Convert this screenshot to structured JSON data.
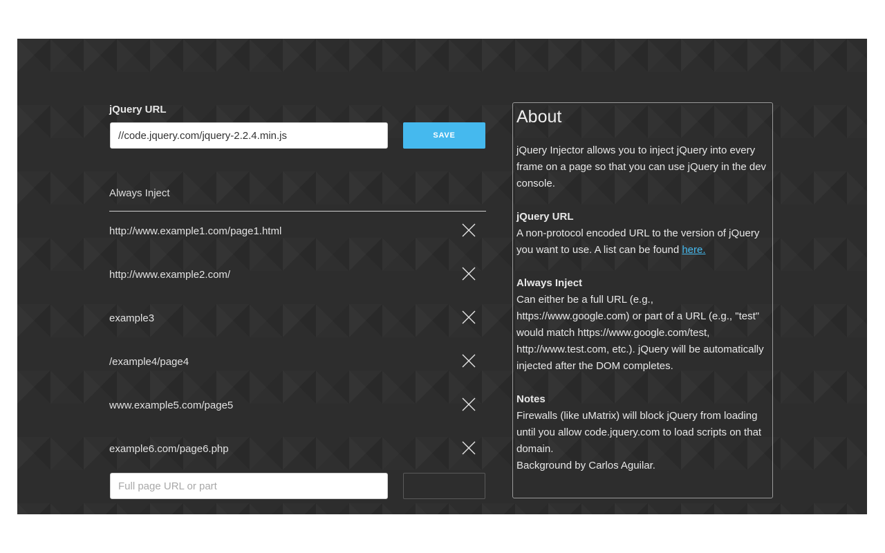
{
  "settings": {
    "jquery_url_label": "jQuery URL",
    "jquery_url_value": "//code.jquery.com/jquery-2.2.4.min.js",
    "save_label": "SAVE",
    "always_inject_label": "Always Inject",
    "inject_items": [
      "http://www.example1.com/page1.html",
      "http://www.example2.com/",
      "example3",
      "/example4/page4",
      "www.example5.com/page5",
      "example6.com/page6.php"
    ],
    "remove_icon": "close-icon",
    "add_placeholder": "Full page URL or part"
  },
  "about": {
    "title": "About",
    "intro": "jQuery Injector allows you to inject jQuery into every frame on a page so that you can use jQuery in the dev console.",
    "jq_title": "jQuery URL",
    "jq_text": "A non-protocol encoded URL to the version of jQuery you want to use. A list can be found ",
    "jq_link": "here.",
    "inject_title": "Always Inject",
    "inject_text": "Can either be a full URL (e.g., https://www.google.com) or part of a URL (e.g., \"test\" would match https://www.google.com/test, http://www.test.com, etc.). jQuery will be automatically injected after the DOM completes.",
    "notes_title": "Notes",
    "notes_text": "Firewalls (like uMatrix) will block jQuery from loading until you allow code.jquery.com to load scripts on that domain.",
    "credit": "Background by Carlos Aguilar."
  },
  "colors": {
    "background": "#2d2d2d",
    "accent": "#45b9ee",
    "text": "#e2e2e2"
  }
}
